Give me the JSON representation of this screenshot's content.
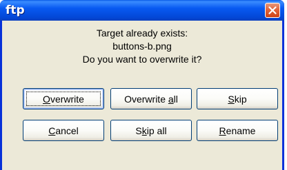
{
  "window": {
    "title": "ftp"
  },
  "message": {
    "line1": "Target already exists:",
    "line2": "buttons-b.png",
    "line3": "Do you want to overwrite it?"
  },
  "buttons": {
    "overwrite": {
      "pre": "",
      "key": "O",
      "post": "verwrite"
    },
    "overwrite_all": {
      "pre": "Overwrite ",
      "key": "a",
      "post": "ll"
    },
    "skip": {
      "pre": "",
      "key": "S",
      "post": "kip"
    },
    "cancel": {
      "pre": "",
      "key": "C",
      "post": "ancel"
    },
    "skip_all": {
      "pre": "S",
      "key": "k",
      "post": "ip all"
    },
    "rename": {
      "pre": "",
      "key": "R",
      "post": "ename"
    }
  },
  "icons": {
    "close": "close-icon"
  },
  "colors": {
    "titlebar": "#0859f1",
    "client": "#ece9d8",
    "close": "#e2643a"
  }
}
